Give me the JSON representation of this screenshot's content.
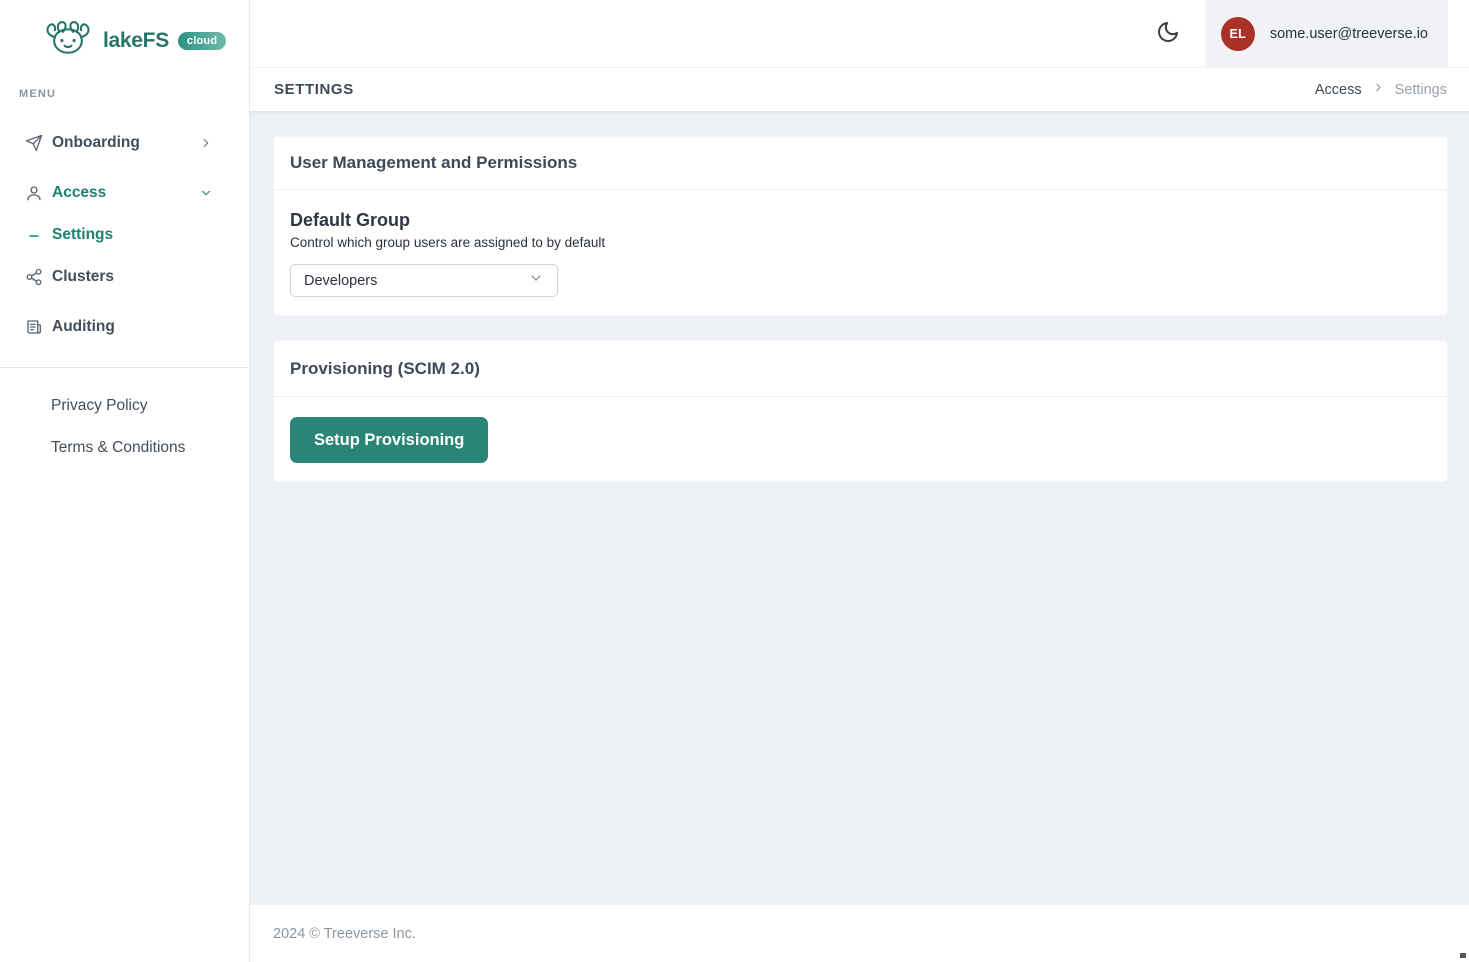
{
  "brand": {
    "name": "lakeFS",
    "badge": "cloud"
  },
  "sidebar": {
    "menu_label": "MENU",
    "items": [
      {
        "label": "Onboarding",
        "icon": "send-icon",
        "chevron": "right",
        "active": false
      },
      {
        "label": "Access",
        "icon": "user-icon",
        "chevron": "down",
        "active": true
      },
      {
        "label": "Settings",
        "icon": "dash-icon",
        "chevron": "none",
        "active": true
      },
      {
        "label": "Clusters",
        "icon": "cluster-icon",
        "chevron": "none",
        "active": false
      },
      {
        "label": "Auditing",
        "icon": "audit-icon",
        "chevron": "none",
        "active": false
      }
    ],
    "footer_links": [
      {
        "label": "Privacy Policy"
      },
      {
        "label": "Terms & Conditions"
      }
    ]
  },
  "header": {
    "theme_toggle_icon": "moon-icon",
    "user_initials": "EL",
    "user_email": "some.user@treeverse.io"
  },
  "page": {
    "title": "SETTINGS",
    "breadcrumb": {
      "parent": "Access",
      "current": "Settings"
    }
  },
  "cards": {
    "user_management": {
      "title": "User Management and Permissions",
      "section": {
        "heading": "Default Group",
        "description": "Control which group users are assigned to by default",
        "select_value": "Developers"
      }
    },
    "provisioning": {
      "title": "Provisioning (SCIM 2.0)",
      "button_label": "Setup Provisioning"
    }
  },
  "footer": {
    "copyright": "2024 © Treeverse Inc."
  },
  "colors": {
    "brand_teal": "#267769",
    "active_teal": "#1f8172",
    "button_teal": "#2a8577",
    "avatar_red": "#a93227",
    "content_bg": "#edf0f4",
    "userbox_bg": "#f0f2f5"
  }
}
